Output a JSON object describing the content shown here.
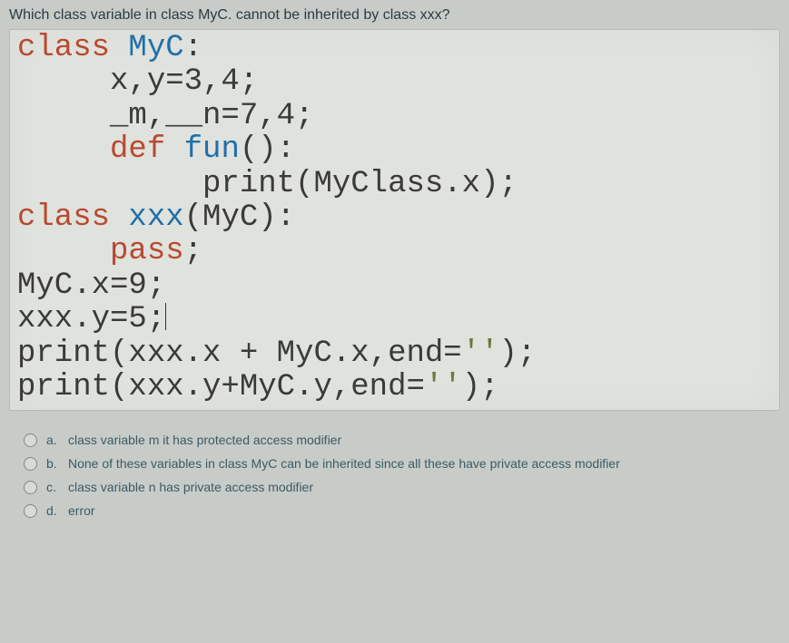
{
  "question": "Which class variable in class MyC. cannot be inherited by class xxx?",
  "code": {
    "l1a": "class ",
    "l1b": "MyC",
    "l1c": ":",
    "l2": "     x,y=3,4;",
    "l3": "     _m,__n=7,4;",
    "l4a": "     ",
    "l4b": "def ",
    "l4c": "fun",
    "l4d": "():",
    "l5": "          print(MyClass.x);",
    "l6a": "class ",
    "l6b": "xxx",
    "l6c": "(MyC):",
    "l7a": "     ",
    "l7b": "pass",
    "l7c": ";",
    "l8": "MyC.x=9;",
    "l9": "xxx.y=5;",
    "l10a": "print(xxx.x + MyC.x,end=",
    "l10b": "''",
    "l10c": ");",
    "l11a": "print(xxx.y+MyC.y,end=",
    "l11b": "''",
    "l11c": ");"
  },
  "options": [
    {
      "letter": "a.",
      "text": "class variable m it has protected access modifier"
    },
    {
      "letter": "b.",
      "text": "None of these variables in class MyC can be inherited since all these have  private access modifier"
    },
    {
      "letter": "c.",
      "text": "class variable n has private access modifier"
    },
    {
      "letter": "d.",
      "text": "error"
    }
  ]
}
